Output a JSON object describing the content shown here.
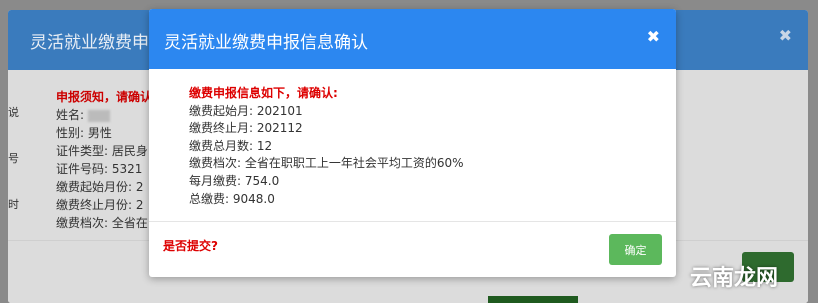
{
  "background_modal": {
    "title": "灵活就业缴费申报",
    "close_glyph": "✖",
    "notice_heading": "申报须知，请确认",
    "fields": [
      {
        "label": "姓名:",
        "value": ""
      },
      {
        "label": "性别:",
        "value": "男性"
      },
      {
        "label": "证件类型:",
        "value": "居民身"
      },
      {
        "label": "证件号码:",
        "value": "5321"
      },
      {
        "label": "缴费起始月份:",
        "value": "2"
      },
      {
        "label": "缴费终止月份:",
        "value": "2"
      },
      {
        "label": "缴费档次:",
        "value": "全省在"
      }
    ],
    "gutter_glyphs": [
      "说",
      "号",
      "时"
    ]
  },
  "modal": {
    "title": "灵活就业缴费申报信息确认",
    "close_glyph": "✖",
    "intro": "缴费申报信息如下，请确认:",
    "items": [
      "缴费起始月: 202101",
      "缴费终止月: 202112",
      "缴费总月数: 12",
      "缴费档次: 全省在职职工上一年社会平均工资的60%",
      "每月缴费: 754.0",
      "总缴费: 9048.0"
    ],
    "question": "是否提交?",
    "confirm_label": "确定"
  },
  "watermark": {
    "text": "云南龙网"
  },
  "colors": {
    "modal_header": "#2c87f0",
    "confirm_button": "#5cb85c",
    "warning_text": "#dd0000"
  }
}
